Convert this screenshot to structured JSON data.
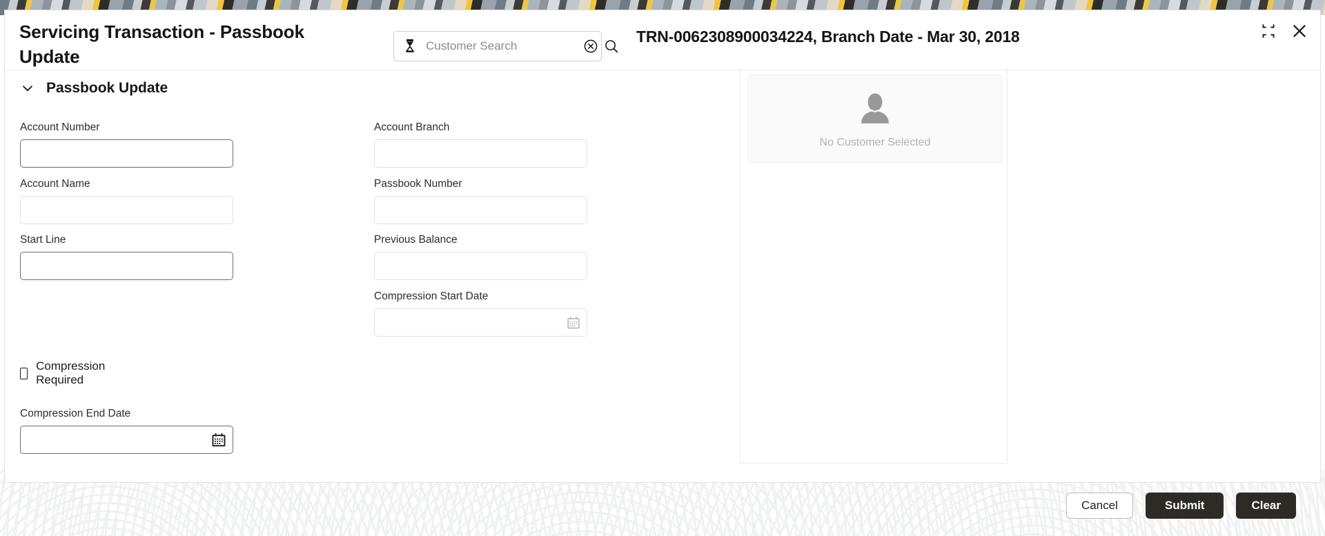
{
  "window": {
    "title": "Servicing Transaction - Passbook Update",
    "transaction_label": "TRN-0062308900034224, Branch Date - Mar 30, 2018",
    "minimize_icon": "minimize-icon",
    "close_icon": "close-icon"
  },
  "search": {
    "placeholder": "Customer Search",
    "value": "",
    "person_icon": "person-icon",
    "clear_icon": "clear-circle-icon",
    "search_icon": "search-icon"
  },
  "section": {
    "title": "Passbook Update",
    "chevron_icon": "chevron-down-icon"
  },
  "form": {
    "fields": [
      {
        "label": "Account Number",
        "value": "",
        "enabled": true,
        "type": "text"
      },
      {
        "label": "Account Branch",
        "value": "",
        "enabled": false,
        "type": "text"
      },
      {
        "label": "Account Name",
        "value": "",
        "enabled": false,
        "type": "text"
      },
      {
        "label": "Passbook Number",
        "value": "",
        "enabled": false,
        "type": "text"
      },
      {
        "label": "Start Line",
        "value": "",
        "enabled": true,
        "type": "text"
      },
      {
        "label": "Previous Balance",
        "value": "",
        "enabled": false,
        "type": "text"
      },
      {
        "label": "Compression Start Date",
        "value": "",
        "enabled": false,
        "type": "date"
      },
      {
        "label": "Compression End Date",
        "value": "",
        "enabled": true,
        "type": "date"
      }
    ],
    "checkbox": {
      "label": "Compression Required",
      "checked": false
    }
  },
  "customer_panel": {
    "empty_text": "No Customer Selected",
    "avatar_icon": "person-avatar-icon"
  },
  "footer": {
    "cancel_label": "Cancel",
    "submit_label": "Submit",
    "clear_label": "Clear"
  },
  "colors": {
    "button_primary": "#2e2a26",
    "text_primary": "#161513",
    "border_enabled": "#6d6d6d",
    "border_disabled": "#e0e0e0",
    "placeholder": "#8b8b8b"
  }
}
